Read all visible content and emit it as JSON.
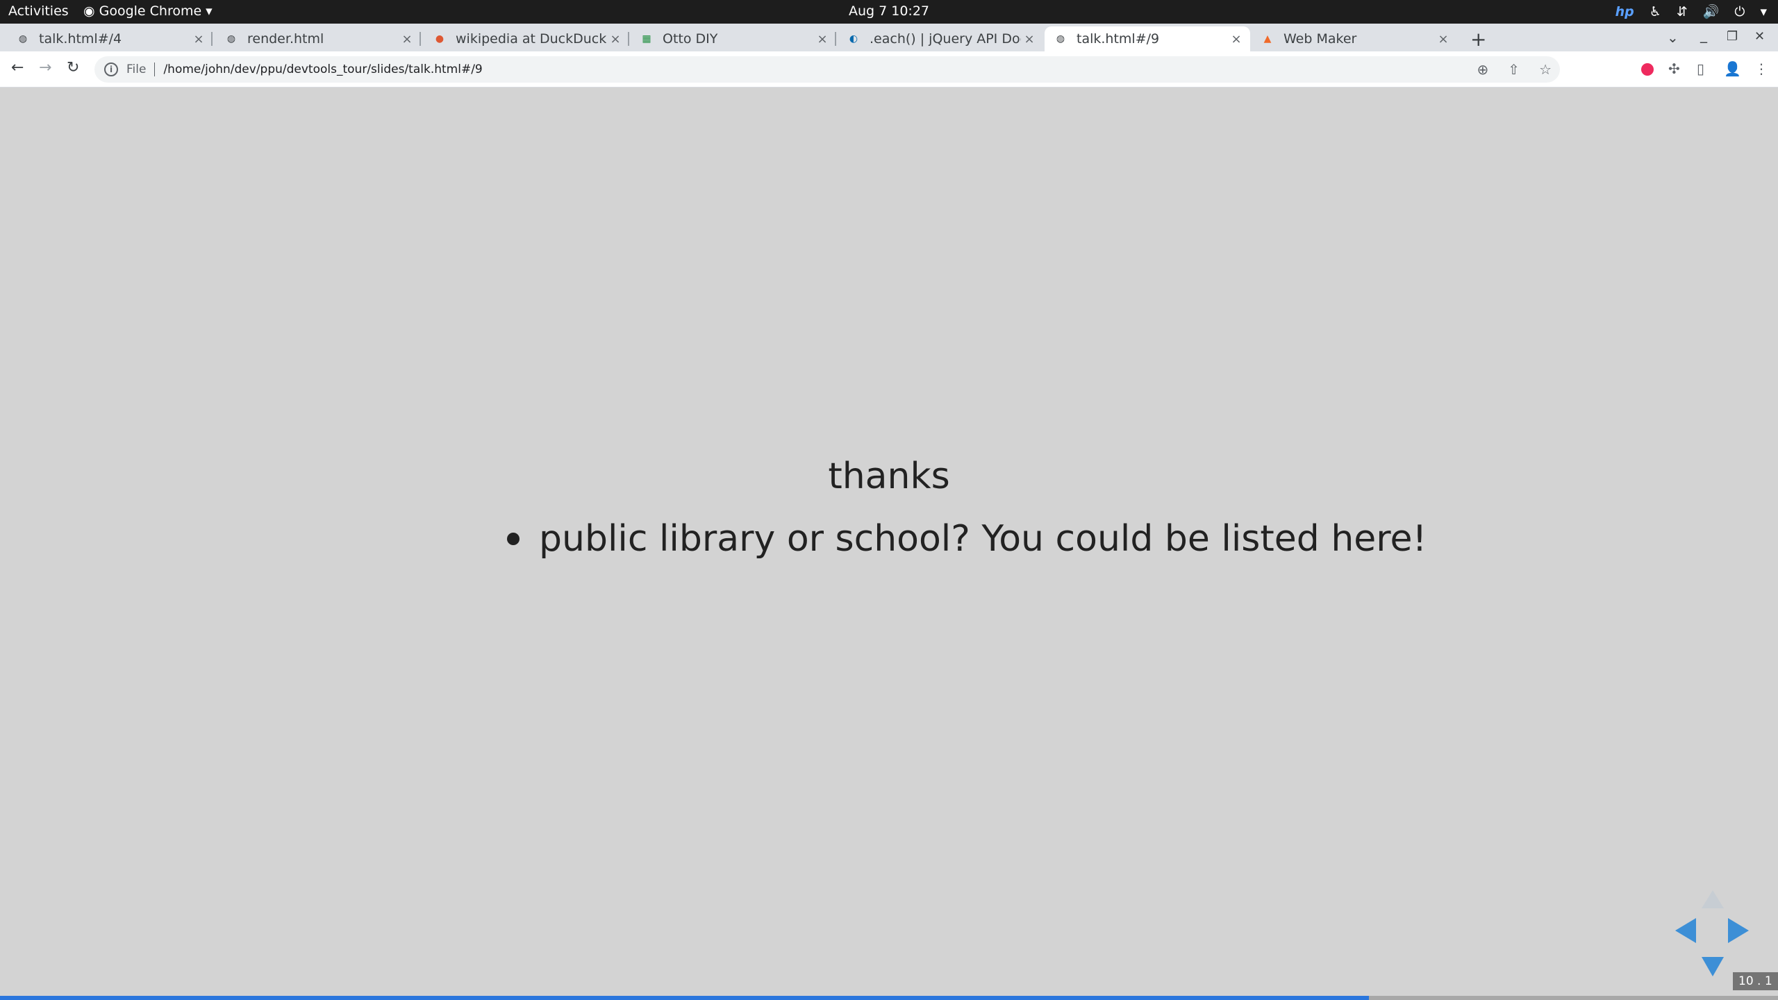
{
  "topbar": {
    "activities": "Activities",
    "app_name": "Google Chrome",
    "app_caret": "▾",
    "clock": "Aug 7  10:27",
    "tray": {
      "hp": "hp",
      "accessibility": "♿",
      "network": "⇵",
      "volume": "🔊",
      "power": "⏻",
      "caret": "▾"
    }
  },
  "tabs": [
    {
      "title": "talk.html#/4",
      "favicon": "globe-icon",
      "glyph": "◍",
      "active": false
    },
    {
      "title": "render.html",
      "favicon": "globe-icon",
      "glyph": "◍",
      "active": false
    },
    {
      "title": "wikipedia at DuckDuckGo",
      "favicon": "duckduckgo-icon",
      "glyph": "●",
      "active": false
    },
    {
      "title": "Otto DIY",
      "favicon": "calendar-icon",
      "glyph": "▦",
      "active": false
    },
    {
      "title": ".each() | jQuery API Docum",
      "favicon": "jquery-icon",
      "glyph": "◐",
      "active": false
    },
    {
      "title": "talk.html#/9",
      "favicon": "globe-icon",
      "glyph": "◍",
      "active": true
    },
    {
      "title": "Web Maker",
      "favicon": "webmaker-icon",
      "glyph": "▲",
      "active": false
    }
  ],
  "tab_close": "×",
  "newtab": "+",
  "window": {
    "tabsearch": "⌄",
    "minimize": "_",
    "restore": "❐",
    "close": "✕"
  },
  "nav": {
    "back": "←",
    "forward": "→",
    "reload": "↻"
  },
  "address": {
    "info": "i",
    "scheme": "File",
    "url": "/home/john/dev/ppu/devtools_tour/slides/talk.html#/9",
    "zoom": "⊕",
    "share": "⇧",
    "star": "☆"
  },
  "extensions": {
    "puzzle": "✣",
    "sidepanel": "▯",
    "profile": "👤",
    "menu": "⋮"
  },
  "slide": {
    "title": "thanks",
    "bullets": [
      "public library or school? You could be listed here!"
    ],
    "number": "10 . 1",
    "progress": 0.77
  },
  "colors": {
    "accent": "#2a76dd",
    "control": "#3d8fd6",
    "background": "#d3d3d3"
  }
}
